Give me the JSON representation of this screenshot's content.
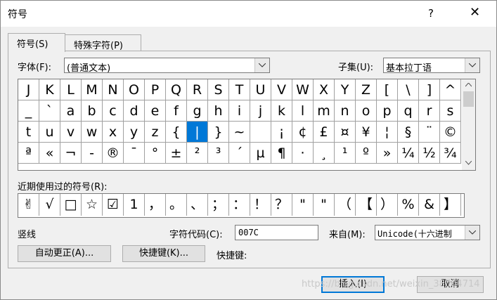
{
  "window": {
    "title": "符号",
    "help": "?",
    "close": "✕"
  },
  "tabs": [
    {
      "label": "符号(S)"
    },
    {
      "label": "特殊字符(P)"
    }
  ],
  "font": {
    "label": "字体(F):",
    "value": "(普通文本)"
  },
  "subset": {
    "label": "子集(U):",
    "value": "基本拉丁语"
  },
  "symbols": [
    [
      "J",
      "K",
      "L",
      "M",
      "N",
      "O",
      "P",
      "Q",
      "R",
      "S",
      "T",
      "U",
      "V",
      "W",
      "X",
      "Y",
      "Z",
      "[",
      "\\",
      "]",
      "^"
    ],
    [
      "_",
      "`",
      "a",
      "b",
      "c",
      "d",
      "e",
      "f",
      "g",
      "h",
      "i",
      "j",
      "k",
      "l",
      "m",
      "n",
      "o",
      "p",
      "q",
      "r",
      "s"
    ],
    [
      "t",
      "u",
      "v",
      "w",
      "x",
      "y",
      "z",
      "{",
      "|",
      "}",
      "~",
      " ",
      "¡",
      "¢",
      "£",
      "¤",
      "¥",
      "¦",
      "§",
      "¨",
      "©"
    ],
    [
      "ª",
      "«",
      "¬",
      "-",
      "®",
      "¯",
      "°",
      "±",
      "²",
      "³",
      "´",
      "µ",
      "¶",
      "·",
      "¸",
      "¹",
      "º",
      "»",
      "¼",
      "½",
      "¾"
    ]
  ],
  "selected_symbol": "|",
  "recent": {
    "label": "近期使用过的符号(R):",
    "symbols": [
      "✌",
      "√",
      "□",
      "☆",
      "☑",
      "1",
      "，",
      "。",
      "、",
      "；",
      "：",
      "！",
      "？",
      "\"",
      "\"",
      "（",
      "【",
      "）",
      "%",
      "&",
      "】"
    ]
  },
  "char_name": "竖线",
  "char_code": {
    "label": "字符代码(C):",
    "value": "007C"
  },
  "from": {
    "label": "来自(M):",
    "value": "Unicode(十六进制"
  },
  "buttons": {
    "autocorrect": "自动更正(A)...",
    "shortcut_key": "快捷键(K)...",
    "shortcut_label": "快捷键:",
    "insert": "插入(I)",
    "cancel": "取消"
  },
  "watermark": "https://blog.csdn.net/weixin_38004714"
}
